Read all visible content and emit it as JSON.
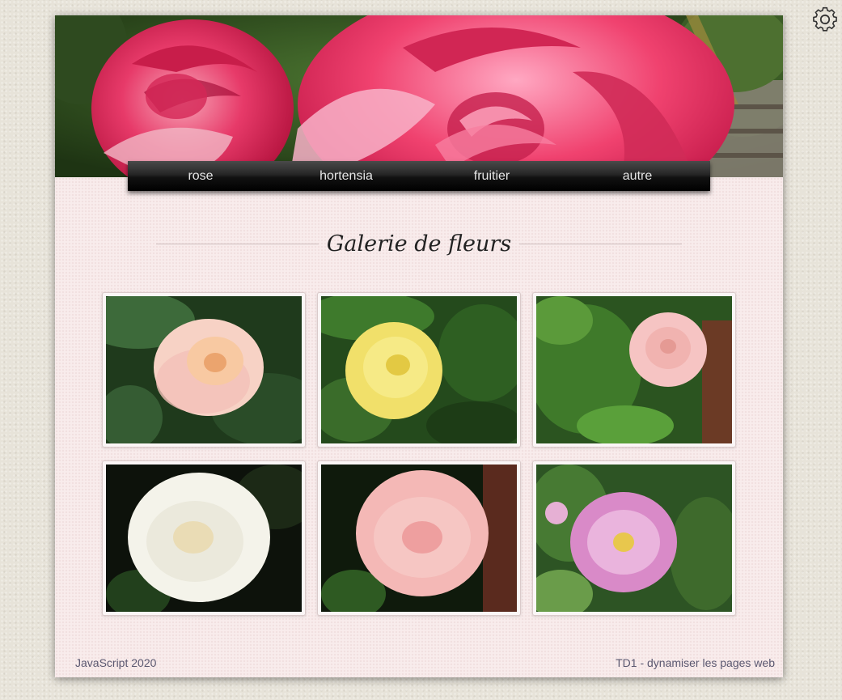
{
  "nav": {
    "items": [
      {
        "label": "rose"
      },
      {
        "label": "hortensia"
      },
      {
        "label": "fruitier"
      },
      {
        "label": "autre"
      }
    ]
  },
  "main": {
    "title": "Galerie de fleurs"
  },
  "gallery": {
    "photos": [
      {
        "subject": "peach-rose",
        "color": "#f6c9b6"
      },
      {
        "subject": "yellow-rose",
        "color": "#f2e15f"
      },
      {
        "subject": "light-pink-rose",
        "color": "#f6c6c3"
      },
      {
        "subject": "white-rose",
        "color": "#f6f4ec"
      },
      {
        "subject": "pink-rose",
        "color": "#f4b6b4"
      },
      {
        "subject": "mauve-rose",
        "color": "#d78ec6"
      }
    ]
  },
  "footer": {
    "left": "JavaScript 2020",
    "right": "TD1 - dynamiser les pages web"
  },
  "colors": {
    "page_background": "#f8ecec",
    "nav_background": "#1b1b1b",
    "nav_text": "#e6e6e6",
    "footer_text": "#5b5870"
  },
  "icons": {
    "settings": "gear-icon"
  }
}
